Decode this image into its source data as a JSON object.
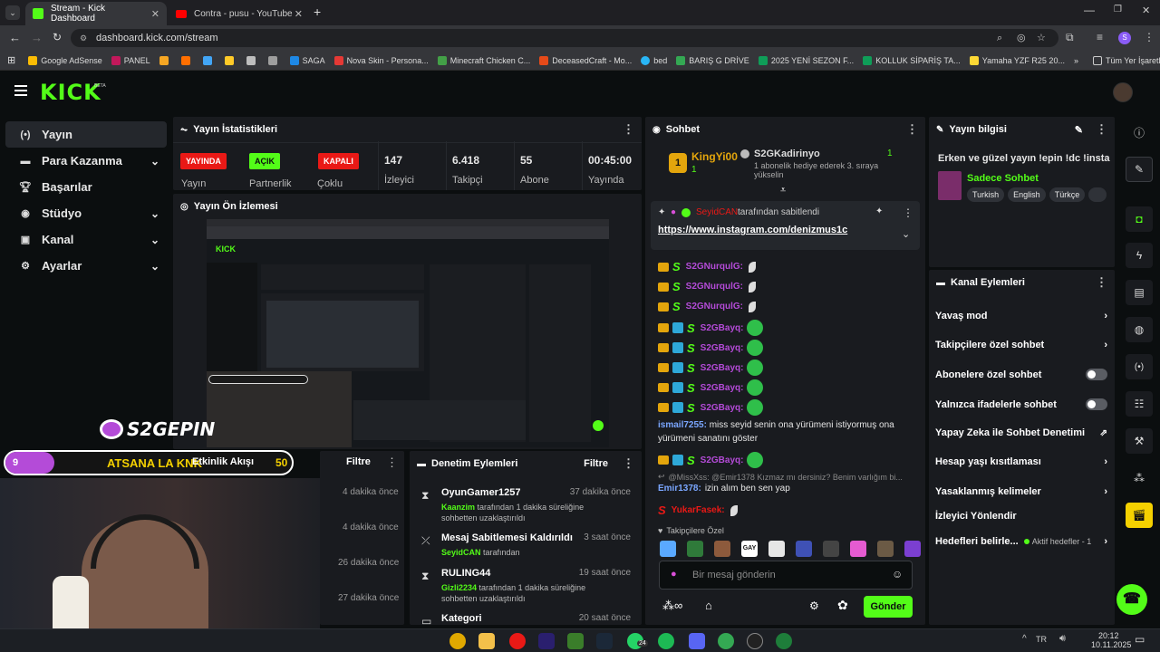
{
  "browser": {
    "tabs": [
      {
        "title": "Stream - Kick Dashboard",
        "active": true
      },
      {
        "title": "Contra - pusu - YouTube",
        "active": false
      }
    ],
    "url": "dashboard.kick.com/stream",
    "bookmarks": [
      "Google AdSense",
      "PANEL",
      "SAGA",
      "Nova Skin - Persona...",
      "Minecraft Chicken C...",
      "DeceasedCraft - Mo...",
      "bed",
      "BARIŞ G DRİVE",
      "2025 YENİ SEZON F...",
      "KOLLUK SİPARİŞ TA...",
      "Yamaha YZF R25 20..."
    ],
    "all_bookmarks": "Tüm Yer İşaretleri",
    "profile_initial": "S"
  },
  "app": {
    "logo": "KICK",
    "logo_sup": "BETA"
  },
  "sidebar": {
    "items": [
      {
        "label": "Yayın",
        "icon": "broadcast-icon",
        "active": true
      },
      {
        "label": "Para Kazanma",
        "icon": "money-icon"
      },
      {
        "label": "Başarılar",
        "icon": "trophy-icon"
      },
      {
        "label": "Stüdyo",
        "icon": "studio-icon"
      },
      {
        "label": "Kanal",
        "icon": "channel-icon"
      },
      {
        "label": "Ayarlar",
        "icon": "gear-icon"
      }
    ]
  },
  "stats": {
    "title": "Yayın İstatistikleri",
    "live_badge": "YAYINDA",
    "live_label": "Yayın",
    "partner_badge": "AÇIK",
    "partner_label": "Partnerlik",
    "multi_badge": "KAPALI",
    "multi_label": "Çoklu",
    "viewers": "147",
    "viewers_label": "İzleyici",
    "followers": "6.418",
    "followers_label": "Takipçi",
    "subs": "55",
    "subs_label": "Abone",
    "uptime": "00:45:00",
    "uptime_label": "Yayında"
  },
  "preview": {
    "title": "Yayın Ön İzlemesi"
  },
  "overlay": {
    "channel": "S2GEPIN",
    "goal_left": "9",
    "goal_text": "ATSANA LA KNK",
    "goal_right": "50"
  },
  "activity": {
    "title": "Etkinlik Akışı",
    "filter": "Filtre",
    "times": [
      "4 dakika önce",
      "4 dakika önce",
      "26 dakika önce",
      "27 dakika önce"
    ]
  },
  "moderation": {
    "title": "Denetim Eylemleri",
    "filter": "Filtre",
    "items": [
      {
        "title": "OyunGamer1257",
        "time": "37 dakika önce",
        "user": "Kaanzim",
        "desc": "tarafından 1 dakika süreliğine sohbetten uzaklaştırıldı",
        "icon": "hourglass-icon"
      },
      {
        "title": "Mesaj Sabitlemesi Kaldırıldı",
        "time": "3 saat önce",
        "user": "SeyidCAN",
        "desc": "tarafından",
        "icon": "unpin-icon"
      },
      {
        "title": "RULING44",
        "time": "19 saat önce",
        "user": "Gizli2234",
        "desc": "tarafından 1 dakika süreliğine sohbetten uzaklaştırıldı",
        "icon": "hourglass-icon"
      },
      {
        "title": "Kategori",
        "time": "20 saat önce",
        "user": "",
        "desc": "",
        "icon": "category-icon"
      }
    ]
  },
  "chat": {
    "title": "Sohbet",
    "top_gifter": "KingYi00",
    "top_gifter_rank": "1",
    "top_gifter_count": "1",
    "gifter2": "S2GKadirinyo",
    "gifter2_count": "1",
    "gifter2_text": "1 abonelik hediye ederek 3. sıraya yükselin",
    "pinned_by": "SeyidCAN",
    "pinned_by_text": "tarafından sabitlendi",
    "pinned_link": "https://www.instagram.com/denizmus1c",
    "messages": [
      {
        "user": "S2GNurqulG:",
        "type": "feather"
      },
      {
        "user": "S2GNurqulG:",
        "type": "feather"
      },
      {
        "user": "S2GNurqulG:",
        "type": "feather"
      },
      {
        "user": "S2GBayq:",
        "type": "emote"
      },
      {
        "user": "S2GBayq:",
        "type": "emote"
      },
      {
        "user": "S2GBayq:",
        "type": "emote"
      },
      {
        "user": "S2GBayq:",
        "type": "emote"
      },
      {
        "user": "S2GBayq:",
        "type": "emote"
      }
    ],
    "msg_ismail_user": "ismail7255:",
    "msg_ismail_text": "miss seyid senin ona yürümeni istiyormuş ona yürümeni sanatını göster",
    "msg_bayq_last": "S2GBayq:",
    "reply_ctx": "@MissXss: @Emir1378 Kızmaz mı dersiniz? Benim varlığım bi...",
    "msg_emir_user": "Emir1378:",
    "msg_emir_text": "izin alım ben sen yap",
    "msg_yukar_user": "YukarFasek:",
    "followers_only": "Takipçilere Özel",
    "emote_gay": "GAY",
    "input_placeholder": "Bir mesaj gönderin",
    "send": "Gönder"
  },
  "stream_info": {
    "title": "Yayın bilgisi",
    "stream_title": "Erken ve güzel yayın !epin !dc !insta",
    "category": "Sadece Sohbet",
    "tags": [
      "Turkish",
      "English",
      "Türkçe"
    ]
  },
  "channel_actions": {
    "title": "Kanal Eylemleri",
    "items": [
      {
        "label": "Yavaş mod",
        "kind": "chevron"
      },
      {
        "label": "Takipçilere özel sohbet",
        "kind": "chevron"
      },
      {
        "label": "Abonelere özel sohbet",
        "kind": "toggle"
      },
      {
        "label": "Yalnızca ifadelerle sohbet",
        "kind": "toggle"
      },
      {
        "label": "Yapay Zeka ile Sohbet Denetimi",
        "kind": "external"
      },
      {
        "label": "Hesap yaşı kısıtlaması",
        "kind": "chevron"
      },
      {
        "label": "Yasaklanmış kelimeler",
        "kind": "chevron"
      },
      {
        "label": "İzleyici Yönlendir",
        "kind": "none"
      },
      {
        "label": "Hedefleri belirle...",
        "kind": "goal"
      }
    ],
    "goal_status": "Aktif hedefler - 1"
  },
  "taskbar": {
    "time": "20:12",
    "date": "10.11.2025",
    "lang": "TR",
    "badge": "24"
  },
  "colors": {
    "accent": "#53fc18",
    "live": "#e91916",
    "panel": "#191b1f",
    "bg": "#0b0e0f"
  }
}
